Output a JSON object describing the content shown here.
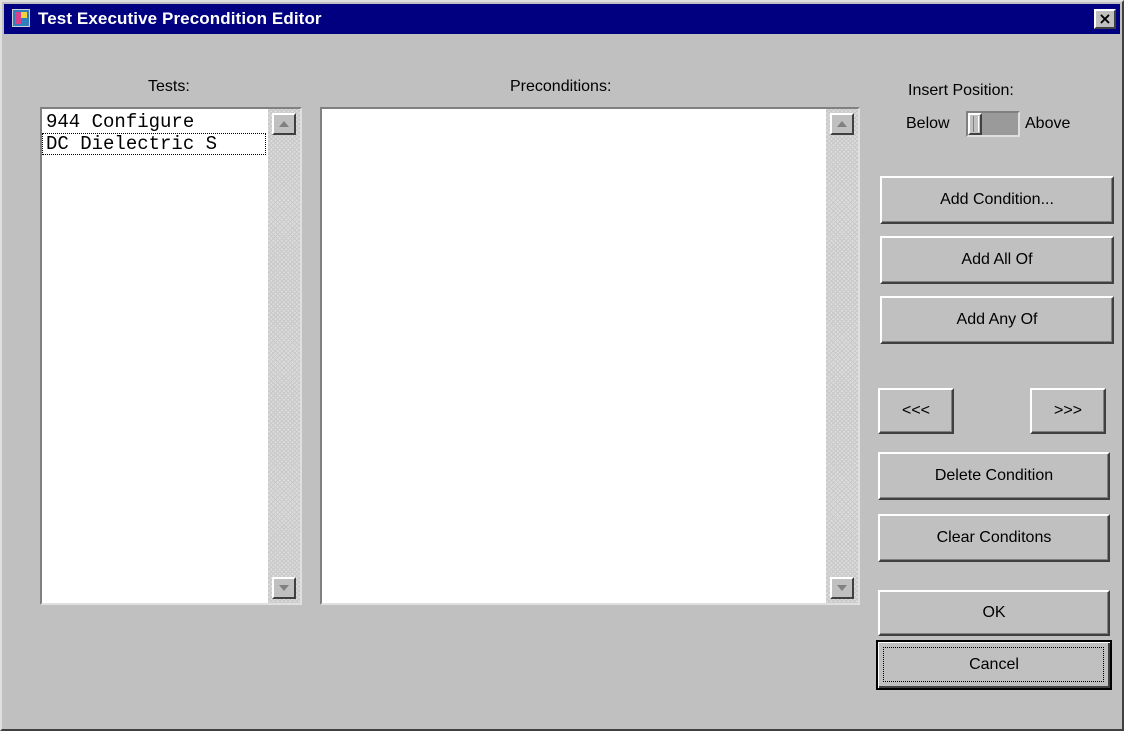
{
  "window": {
    "title": "Test Executive Precondition Editor",
    "close_label": "×"
  },
  "tests": {
    "label": "Tests:",
    "items": [
      "944 Configure",
      "DC Dielectric S"
    ]
  },
  "preconditions": {
    "label": "Preconditions:",
    "items": []
  },
  "insert_position": {
    "label": "Insert Position:",
    "below_label": "Below",
    "above_label": "Above"
  },
  "buttons": {
    "add_condition": "Add Condition...",
    "add_all_of": "Add All Of",
    "add_any_of": "Add Any Of",
    "move_left": "<<<",
    "move_right": ">>>",
    "delete_condition": "Delete Condition",
    "clear_conditions": "Clear Conditons",
    "ok": "OK",
    "cancel": "Cancel"
  },
  "colors": {
    "titlebar": "#000080",
    "face": "#c0c0c0"
  }
}
